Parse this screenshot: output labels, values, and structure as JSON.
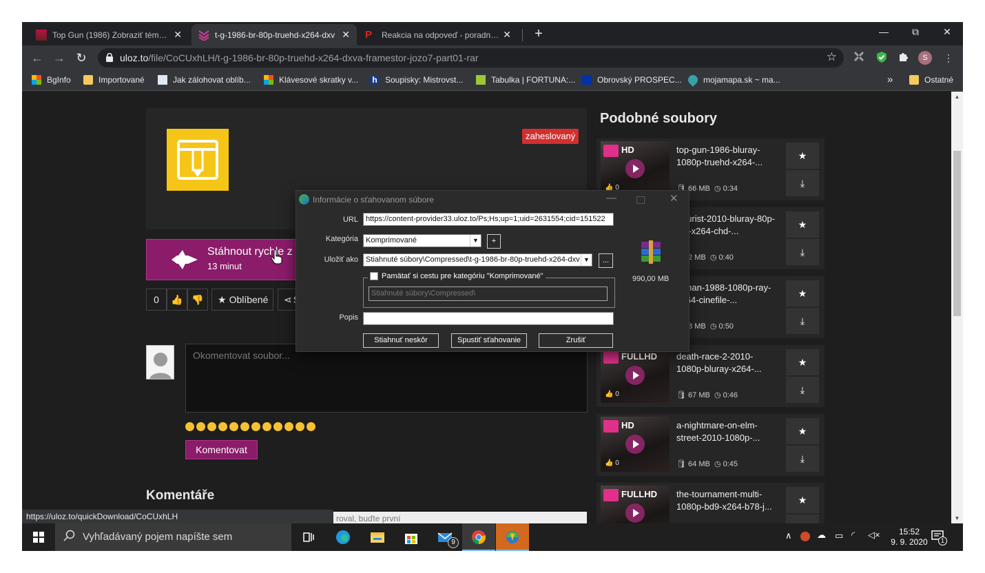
{
  "tabs": [
    {
      "title": "Top Gun (1986) Zobraziť tému - W",
      "close": "✕"
    },
    {
      "title": "t-g-1986-br-80p-truehd-x264-dxv",
      "close": "✕"
    },
    {
      "title": "Reakcia na odpoveď - poradna.n",
      "close": "✕"
    }
  ],
  "newtab": "+",
  "window_controls": {
    "minimize": "—",
    "maximize": "⧉",
    "close": "✕"
  },
  "nav": {
    "back": "←",
    "forward": "→",
    "reload": "↻"
  },
  "address": {
    "host": "uloz.to",
    "path": "/file/CoCUxhLH/t-g-1986-br-80p-truehd-x264-dxva-framestor-jozo7-part01-rar"
  },
  "profile_initial": "S",
  "bookmarks": [
    {
      "label": "BgInfo"
    },
    {
      "label": "Importované"
    },
    {
      "label": "Jak zálohovat oblíb..."
    },
    {
      "label": "Klávesové skratky v..."
    },
    {
      "label": "Soupisky: Mistrovst..."
    },
    {
      "label": "Tabulka | FORTUNA:..."
    },
    {
      "label": "Obrovský PROSPEC..."
    },
    {
      "label": "mojamapa.sk ~ ma..."
    }
  ],
  "bookmarks_more": "»",
  "bookmarks_other": "Ostatné",
  "file": {
    "badge": "zaheslovaný",
    "download_title": "Stáhnout rychle z",
    "download_sub": "13 minut",
    "likes": "0",
    "favorite_label": "Oblíbené",
    "share_label": "S"
  },
  "comment": {
    "placeholder": "Okomentovat soubor...",
    "button": "Komentovat",
    "heading": "Komentáře",
    "empty_text": "roval, buďte první"
  },
  "similar": {
    "heading": "Podobné soubory",
    "items": [
      {
        "quality": "HD",
        "likes": "0",
        "name": "top-gun-1986-bluray-1080p-truehd-x264-...",
        "size": "66 MB",
        "duration": "0:34"
      },
      {
        "quality": "",
        "likes": "",
        "name": "-tourist-2010-bluray-80p-dts-x264-chd-...",
        "size": "2 MB",
        "duration": "0:40"
      },
      {
        "quality": "",
        "likes": "",
        "name": "n-man-1988-1080p-ray-x264-cinefile-...",
        "size": "8 MB",
        "duration": "0:50"
      },
      {
        "quality": "FULLHD",
        "likes": "0",
        "name": "death-race-2-2010-1080p-bluray-x264-...",
        "size": "67 MB",
        "duration": "0:46"
      },
      {
        "quality": "HD",
        "likes": "0",
        "name": "a-nightmare-on-elm-street-2010-1080p-...",
        "size": "64 MB",
        "duration": "0:45"
      },
      {
        "quality": "FULLHD",
        "likes": "",
        "name": "the-tournament-multi-1080p-bd9-x264-b78-j...",
        "size": "",
        "duration": ""
      }
    ]
  },
  "dialog": {
    "title": "Informácie o sťahovanom súbore",
    "url_label": "URL",
    "url_value": "https://content-provider33.uloz.to/Ps;Hs;up=1;uid=2631554;cid=151522",
    "category_label": "Kategória",
    "category_value": "Komprimované",
    "add": "+",
    "save_label": "Uložiť ako",
    "save_value": "Stiahnuté súbory\\Compressed\\t-g-1986-br-80p-truehd-x264-dxv",
    "browse": "...",
    "remember_label": "Pamätať si cestu pre kategóriu \"Komprimované\"",
    "remember_path": "Stiahnuté súbory\\Compressed\\",
    "description_label": "Popis",
    "description_value": "",
    "size": "990,00  MB",
    "btn_later": "Stiahnuť neskôr",
    "btn_start": "Spustiť sťahovanie",
    "btn_cancel": "Zrušiť",
    "close": "✕",
    "minimize": "—"
  },
  "status_url": "https://uloz.to/quickDownload/CoCUxhLH",
  "taskbar": {
    "search_placeholder": "Vyhľadávaný pojem napíšte sem",
    "mail_badge": "9",
    "time": "15:52",
    "date": "9. 9. 2020",
    "notif_badge": "1"
  }
}
